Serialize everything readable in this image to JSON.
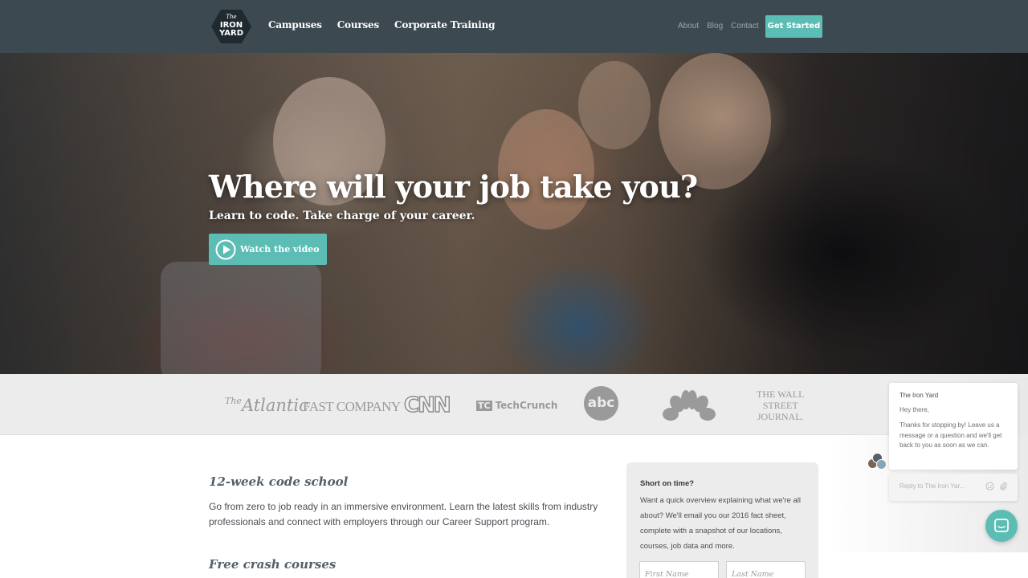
{
  "nav": {
    "logo_line1": "The",
    "logo_line2": "IRON",
    "logo_line3": "YARD",
    "main": [
      "Campuses",
      "Courses",
      "Corporate Training"
    ],
    "secondary": [
      "About",
      "Blog",
      "Contact"
    ],
    "cta": "Get Started"
  },
  "hero": {
    "title": "Where will your job take you?",
    "subtitle": "Learn to code. Take charge of your career.",
    "video_button": "Watch the video",
    "play_icon": "play-circle-icon"
  },
  "press": {
    "logos": [
      "The Atlantic",
      "FAST COMPANY",
      "CNN",
      "TechCrunch",
      "abc",
      "NBC",
      "THE WALL STREET JOURNAL"
    ],
    "atlantic": "Atlantic",
    "fast": "FAST COMPANY",
    "cnn": "CNN",
    "tc_mark": "TC",
    "tc": "TechCrunch",
    "abc": "abc",
    "wsj_line1": "THE WALL",
    "wsj_line2": "STREET",
    "wsj_line3": "JOURNAL."
  },
  "content": {
    "school_heading": "12-week code school",
    "school_text": "Go from zero to job ready in an immersive environment. Learn the latest skills from industry professionals and connect with employers through our Career Support program.",
    "crash_heading": "Free crash courses"
  },
  "side_form": {
    "title": "Short on time?",
    "description": "Want a quick overview explaining what we're all about? We'll email you our 2016 fact sheet, complete with a snapshot of our locations, courses, job data and more.",
    "first_name_placeholder": "First Name",
    "last_name_placeholder": "Last Name"
  },
  "chat": {
    "from": "The Iron Yard",
    "greeting": "Hey there,",
    "message": "Thanks for stopping by! Leave us a message or a question and we'll get back to you as soon as we can.",
    "reply_placeholder": "Reply to The Iron Yar...",
    "emoji_icon": "emoji-icon",
    "attach_icon": "paperclip-icon",
    "launcher_icon": "chat-bubble-icon"
  },
  "colors": {
    "nav_bg": "#3c4950",
    "accent": "#5cbdb5",
    "press_bg": "#ececec"
  }
}
